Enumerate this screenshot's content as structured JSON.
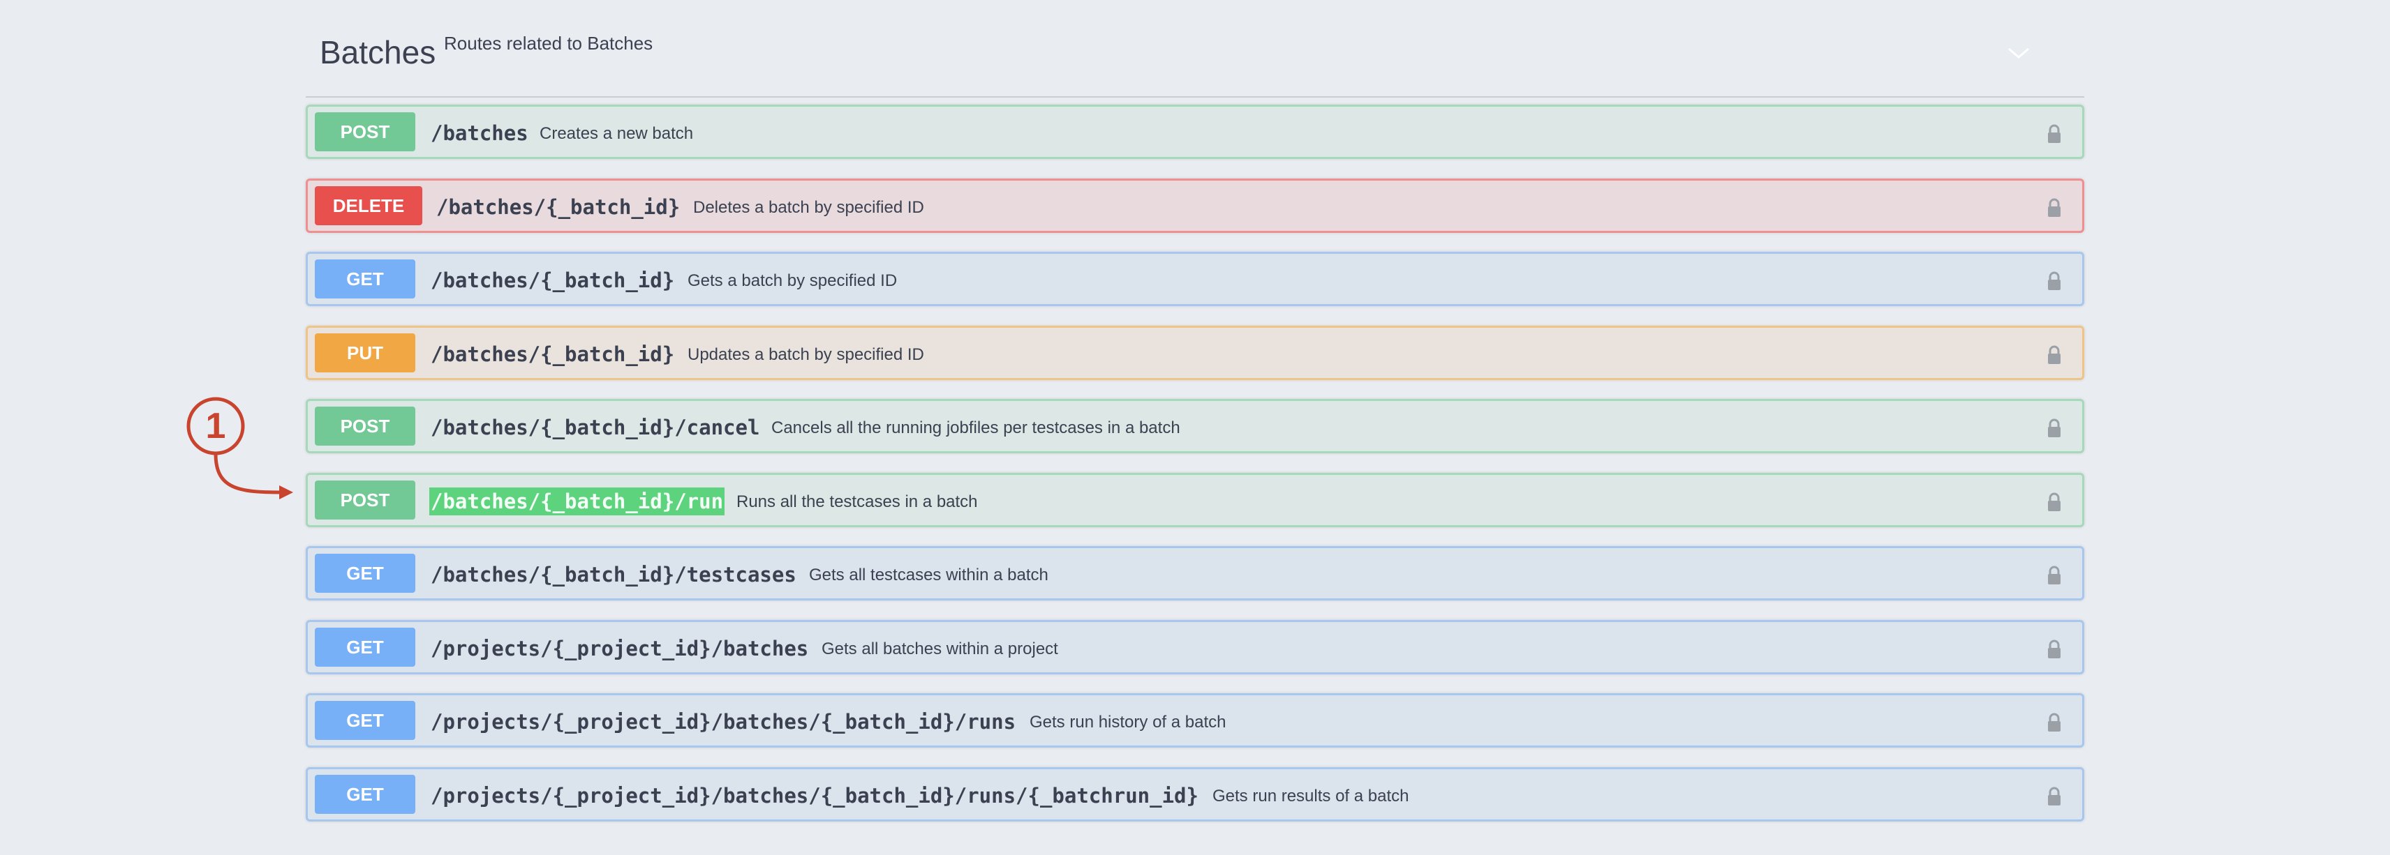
{
  "tag": {
    "name": "Batches",
    "description": "Routes related to Batches",
    "collapse_icon": "chevron-down-icon"
  },
  "operations": [
    {
      "method": "POST",
      "path": "/batches",
      "summary": "Creates a new batch",
      "locked": true
    },
    {
      "method": "DELETE",
      "path": "/batches/{_batch_id}",
      "summary": "Deletes a batch by specified ID",
      "locked": true
    },
    {
      "method": "GET",
      "path": "/batches/{_batch_id}",
      "summary": "Gets a batch by specified ID",
      "locked": true
    },
    {
      "method": "PUT",
      "path": "/batches/{_batch_id}",
      "summary": "Updates a batch by specified ID",
      "locked": true
    },
    {
      "method": "POST",
      "path": "/batches/{_batch_id}/cancel",
      "summary": "Cancels all the running jobfiles per testcases in a batch",
      "locked": true
    },
    {
      "method": "POST",
      "path": "/batches/{_batch_id}/run",
      "summary": "Runs all the testcases in a batch",
      "locked": true,
      "highlighted": true
    },
    {
      "method": "GET",
      "path": "/batches/{_batch_id}/testcases",
      "summary": "Gets all testcases within a batch",
      "locked": true
    },
    {
      "method": "GET",
      "path": "/projects/{_project_id}/batches",
      "summary": "Gets all batches within a project",
      "locked": true
    },
    {
      "method": "GET",
      "path": "/projects/{_project_id}/batches/{_batch_id}/runs",
      "summary": "Gets run history of a batch",
      "locked": true
    },
    {
      "method": "GET",
      "path": "/projects/{_project_id}/batches/{_batch_id}/runs/{_batchrun_id}",
      "summary": "Gets run results of a batch",
      "locked": true
    }
  ],
  "annotation": {
    "number": "1",
    "color": "#c9442f"
  },
  "colors": {
    "post": "#72c996",
    "delete": "#e8504d",
    "get": "#78b0f7",
    "put": "#f1a743",
    "highlight": "#5ed37d"
  }
}
